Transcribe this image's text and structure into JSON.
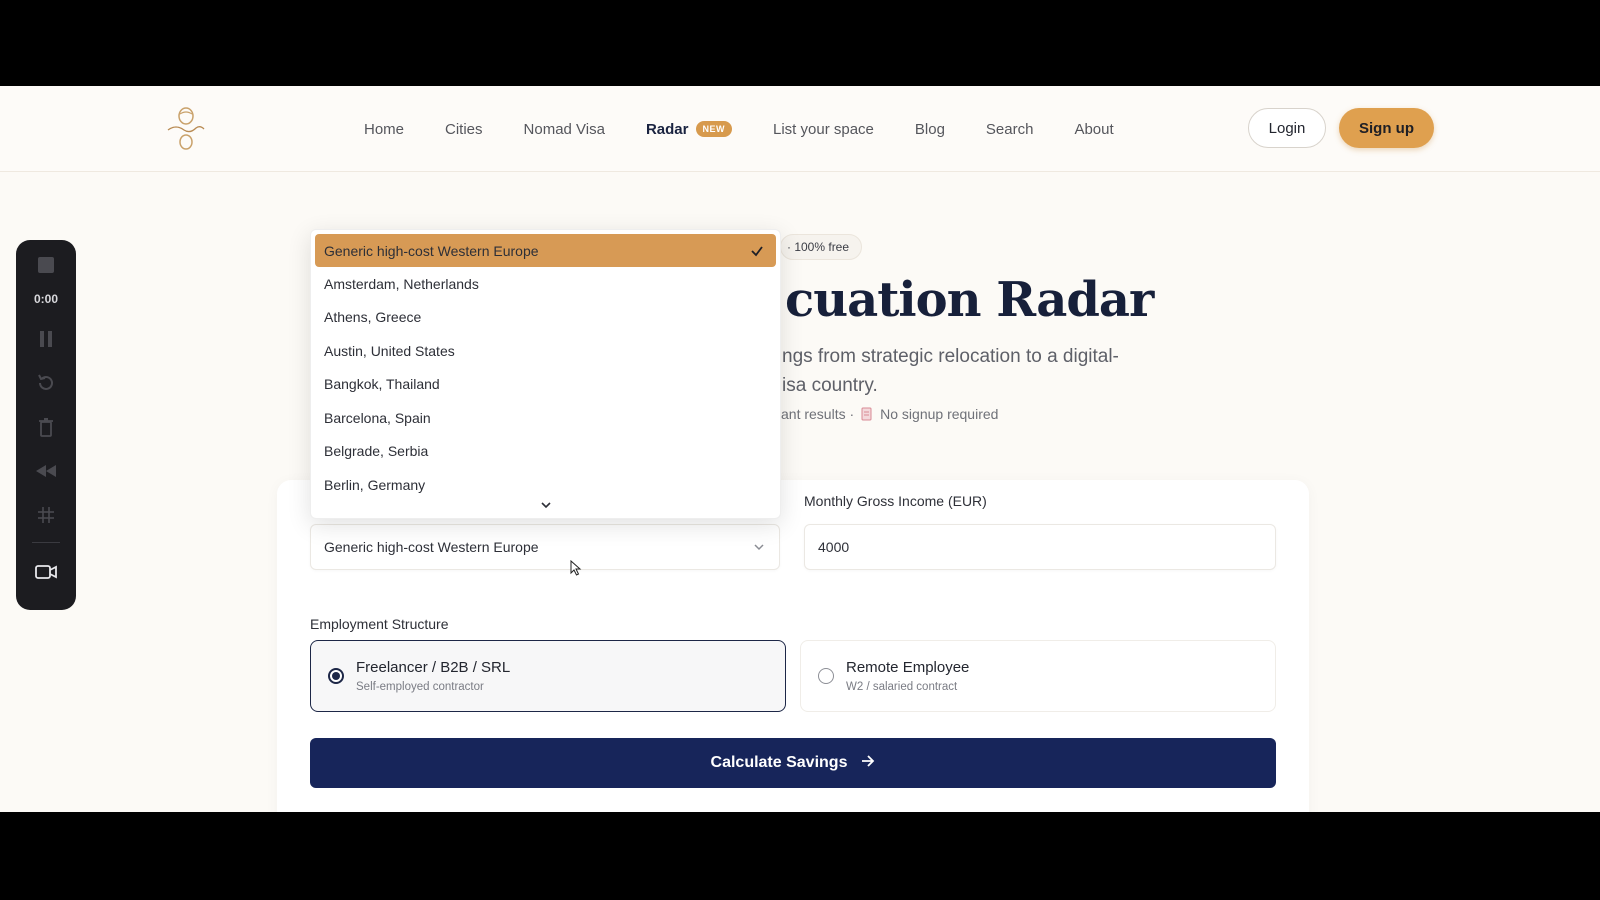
{
  "nav": {
    "items": [
      {
        "label": "Home"
      },
      {
        "label": "Cities"
      },
      {
        "label": "Nomad Visa"
      },
      {
        "label": "Radar",
        "badge": "NEW",
        "active": true
      },
      {
        "label": "List your space"
      },
      {
        "label": "Blog"
      },
      {
        "label": "Search"
      },
      {
        "label": "About"
      }
    ],
    "login": "Login",
    "signup": "Sign up",
    "accent": "#dfa04f"
  },
  "recorder": {
    "time": "0:00",
    "icons": [
      "stop-icon",
      "pause-icon",
      "restart-icon",
      "trash-icon",
      "rewind-icon",
      "grid-icon",
      "camera-icon"
    ]
  },
  "hero": {
    "pill": "· 100% free",
    "title": "cuation Radar",
    "subtitle_line1": "ngs from strategic relocation to a digital-",
    "subtitle_line2": "isa country.",
    "meta_left": "ant results ·",
    "meta_right": "No signup required"
  },
  "form": {
    "income_label": "Monthly Gross Income (EUR)",
    "income_value": "4000",
    "city_value": "Generic high-cost Western Europe",
    "employment_label": "Employment Structure",
    "options": [
      {
        "title": "Freelancer / B2B / SRL",
        "sub": "Self-employed contractor",
        "selected": true
      },
      {
        "title": "Remote Employee",
        "sub": "W2 / salaried contract",
        "selected": false
      }
    ],
    "submit": "Calculate Savings",
    "primary_color": "#17255a"
  },
  "dropdown": {
    "options": [
      "Generic high-cost Western Europe",
      "Amsterdam, Netherlands",
      "Athens, Greece",
      "Austin, United States",
      "Bangkok, Thailand",
      "Barcelona, Spain",
      "Belgrade, Serbia",
      "Berlin, Germany"
    ],
    "selected_index": 0,
    "highlight": "#d79a55"
  }
}
